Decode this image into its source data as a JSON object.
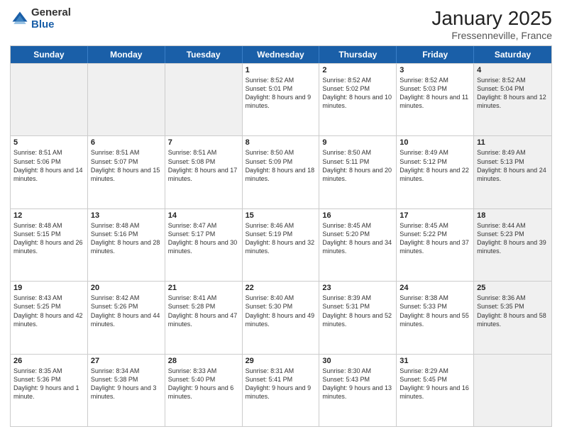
{
  "logo": {
    "general": "General",
    "blue": "Blue"
  },
  "title": {
    "month": "January 2025",
    "location": "Fressenneville, France"
  },
  "header_days": [
    "Sunday",
    "Monday",
    "Tuesday",
    "Wednesday",
    "Thursday",
    "Friday",
    "Saturday"
  ],
  "rows": [
    [
      {
        "day": "",
        "sunrise": "",
        "sunset": "",
        "daylight": "",
        "shaded": true
      },
      {
        "day": "",
        "sunrise": "",
        "sunset": "",
        "daylight": "",
        "shaded": true
      },
      {
        "day": "",
        "sunrise": "",
        "sunset": "",
        "daylight": "",
        "shaded": true
      },
      {
        "day": "1",
        "sunrise": "Sunrise: 8:52 AM",
        "sunset": "Sunset: 5:01 PM",
        "daylight": "Daylight: 8 hours and 9 minutes.",
        "shaded": false
      },
      {
        "day": "2",
        "sunrise": "Sunrise: 8:52 AM",
        "sunset": "Sunset: 5:02 PM",
        "daylight": "Daylight: 8 hours and 10 minutes.",
        "shaded": false
      },
      {
        "day": "3",
        "sunrise": "Sunrise: 8:52 AM",
        "sunset": "Sunset: 5:03 PM",
        "daylight": "Daylight: 8 hours and 11 minutes.",
        "shaded": false
      },
      {
        "day": "4",
        "sunrise": "Sunrise: 8:52 AM",
        "sunset": "Sunset: 5:04 PM",
        "daylight": "Daylight: 8 hours and 12 minutes.",
        "shaded": true
      }
    ],
    [
      {
        "day": "5",
        "sunrise": "Sunrise: 8:51 AM",
        "sunset": "Sunset: 5:06 PM",
        "daylight": "Daylight: 8 hours and 14 minutes.",
        "shaded": false
      },
      {
        "day": "6",
        "sunrise": "Sunrise: 8:51 AM",
        "sunset": "Sunset: 5:07 PM",
        "daylight": "Daylight: 8 hours and 15 minutes.",
        "shaded": false
      },
      {
        "day": "7",
        "sunrise": "Sunrise: 8:51 AM",
        "sunset": "Sunset: 5:08 PM",
        "daylight": "Daylight: 8 hours and 17 minutes.",
        "shaded": false
      },
      {
        "day": "8",
        "sunrise": "Sunrise: 8:50 AM",
        "sunset": "Sunset: 5:09 PM",
        "daylight": "Daylight: 8 hours and 18 minutes.",
        "shaded": false
      },
      {
        "day": "9",
        "sunrise": "Sunrise: 8:50 AM",
        "sunset": "Sunset: 5:11 PM",
        "daylight": "Daylight: 8 hours and 20 minutes.",
        "shaded": false
      },
      {
        "day": "10",
        "sunrise": "Sunrise: 8:49 AM",
        "sunset": "Sunset: 5:12 PM",
        "daylight": "Daylight: 8 hours and 22 minutes.",
        "shaded": false
      },
      {
        "day": "11",
        "sunrise": "Sunrise: 8:49 AM",
        "sunset": "Sunset: 5:13 PM",
        "daylight": "Daylight: 8 hours and 24 minutes.",
        "shaded": true
      }
    ],
    [
      {
        "day": "12",
        "sunrise": "Sunrise: 8:48 AM",
        "sunset": "Sunset: 5:15 PM",
        "daylight": "Daylight: 8 hours and 26 minutes.",
        "shaded": false
      },
      {
        "day": "13",
        "sunrise": "Sunrise: 8:48 AM",
        "sunset": "Sunset: 5:16 PM",
        "daylight": "Daylight: 8 hours and 28 minutes.",
        "shaded": false
      },
      {
        "day": "14",
        "sunrise": "Sunrise: 8:47 AM",
        "sunset": "Sunset: 5:17 PM",
        "daylight": "Daylight: 8 hours and 30 minutes.",
        "shaded": false
      },
      {
        "day": "15",
        "sunrise": "Sunrise: 8:46 AM",
        "sunset": "Sunset: 5:19 PM",
        "daylight": "Daylight: 8 hours and 32 minutes.",
        "shaded": false
      },
      {
        "day": "16",
        "sunrise": "Sunrise: 8:45 AM",
        "sunset": "Sunset: 5:20 PM",
        "daylight": "Daylight: 8 hours and 34 minutes.",
        "shaded": false
      },
      {
        "day": "17",
        "sunrise": "Sunrise: 8:45 AM",
        "sunset": "Sunset: 5:22 PM",
        "daylight": "Daylight: 8 hours and 37 minutes.",
        "shaded": false
      },
      {
        "day": "18",
        "sunrise": "Sunrise: 8:44 AM",
        "sunset": "Sunset: 5:23 PM",
        "daylight": "Daylight: 8 hours and 39 minutes.",
        "shaded": true
      }
    ],
    [
      {
        "day": "19",
        "sunrise": "Sunrise: 8:43 AM",
        "sunset": "Sunset: 5:25 PM",
        "daylight": "Daylight: 8 hours and 42 minutes.",
        "shaded": false
      },
      {
        "day": "20",
        "sunrise": "Sunrise: 8:42 AM",
        "sunset": "Sunset: 5:26 PM",
        "daylight": "Daylight: 8 hours and 44 minutes.",
        "shaded": false
      },
      {
        "day": "21",
        "sunrise": "Sunrise: 8:41 AM",
        "sunset": "Sunset: 5:28 PM",
        "daylight": "Daylight: 8 hours and 47 minutes.",
        "shaded": false
      },
      {
        "day": "22",
        "sunrise": "Sunrise: 8:40 AM",
        "sunset": "Sunset: 5:30 PM",
        "daylight": "Daylight: 8 hours and 49 minutes.",
        "shaded": false
      },
      {
        "day": "23",
        "sunrise": "Sunrise: 8:39 AM",
        "sunset": "Sunset: 5:31 PM",
        "daylight": "Daylight: 8 hours and 52 minutes.",
        "shaded": false
      },
      {
        "day": "24",
        "sunrise": "Sunrise: 8:38 AM",
        "sunset": "Sunset: 5:33 PM",
        "daylight": "Daylight: 8 hours and 55 minutes.",
        "shaded": false
      },
      {
        "day": "25",
        "sunrise": "Sunrise: 8:36 AM",
        "sunset": "Sunset: 5:35 PM",
        "daylight": "Daylight: 8 hours and 58 minutes.",
        "shaded": true
      }
    ],
    [
      {
        "day": "26",
        "sunrise": "Sunrise: 8:35 AM",
        "sunset": "Sunset: 5:36 PM",
        "daylight": "Daylight: 9 hours and 1 minute.",
        "shaded": false
      },
      {
        "day": "27",
        "sunrise": "Sunrise: 8:34 AM",
        "sunset": "Sunset: 5:38 PM",
        "daylight": "Daylight: 9 hours and 3 minutes.",
        "shaded": false
      },
      {
        "day": "28",
        "sunrise": "Sunrise: 8:33 AM",
        "sunset": "Sunset: 5:40 PM",
        "daylight": "Daylight: 9 hours and 6 minutes.",
        "shaded": false
      },
      {
        "day": "29",
        "sunrise": "Sunrise: 8:31 AM",
        "sunset": "Sunset: 5:41 PM",
        "daylight": "Daylight: 9 hours and 9 minutes.",
        "shaded": false
      },
      {
        "day": "30",
        "sunrise": "Sunrise: 8:30 AM",
        "sunset": "Sunset: 5:43 PM",
        "daylight": "Daylight: 9 hours and 13 minutes.",
        "shaded": false
      },
      {
        "day": "31",
        "sunrise": "Sunrise: 8:29 AM",
        "sunset": "Sunset: 5:45 PM",
        "daylight": "Daylight: 9 hours and 16 minutes.",
        "shaded": false
      },
      {
        "day": "",
        "sunrise": "",
        "sunset": "",
        "daylight": "",
        "shaded": true
      }
    ]
  ]
}
